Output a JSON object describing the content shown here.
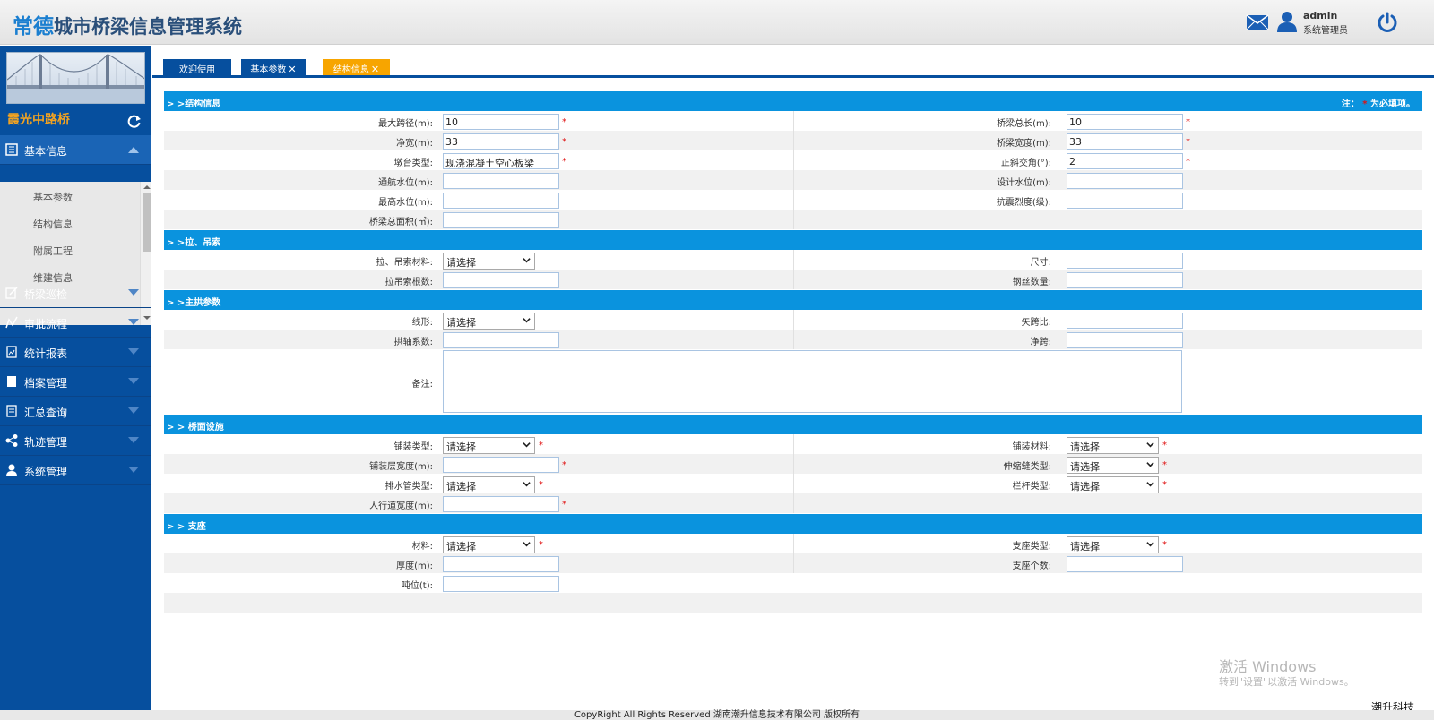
{
  "header": {
    "brand": "常德",
    "title_rest": "城市桥梁信息管理系统",
    "username": "admin",
    "role": "系统管理员"
  },
  "sidebar": {
    "bridge_name": "霞光中路桥",
    "groups": [
      {
        "label": "基本信息",
        "icon": "info-icon"
      },
      {
        "label": "桥梁巡检",
        "icon": "edit-icon"
      },
      {
        "label": "审批流程",
        "icon": "flow-icon"
      },
      {
        "label": "统计报表",
        "icon": "report-icon"
      },
      {
        "label": "档案管理",
        "icon": "archive-icon"
      },
      {
        "label": "汇总查询",
        "icon": "query-icon"
      },
      {
        "label": "轨迹管理",
        "icon": "share-icon"
      },
      {
        "label": "系统管理",
        "icon": "user-icon"
      }
    ],
    "sub_items": [
      "基本参数",
      "结构信息",
      "附属工程",
      "维建信息"
    ]
  },
  "tabs": {
    "welcome": "欢迎使用",
    "basic": "基本参数",
    "struct": "结构信息"
  },
  "sections": {
    "structure": "> >结构信息",
    "note_prefix": "注：",
    "note_star": "*",
    "note_suffix": "为必填项。",
    "cable": "> >拉、吊索",
    "arch": "> >主拱参数",
    "deck": "> > 桥面设施",
    "bearing": "> > 支座"
  },
  "structure": {
    "max_span_label": "最大跨径(m):",
    "max_span": "10",
    "total_length_label": "桥梁总长(m):",
    "total_length": "10",
    "net_width_label": "净宽(m):",
    "net_width": "33",
    "bridge_width_label": "桥梁宽度(m):",
    "bridge_width": "33",
    "abutment_label": "墩台类型:",
    "abutment": "现浇混凝土空心板梁",
    "skew_label": "正斜交角(°):",
    "skew": "2",
    "nav_level_label": "通航水位(m):",
    "design_level_label": "设计水位(m):",
    "max_level_label": "最高水位(m):",
    "seismic_label": "抗震烈度(级):",
    "area_label": "桥梁总面积(㎡):"
  },
  "cable": {
    "material_label": "拉、吊索材料:",
    "material": "请选择",
    "size_label": "尺寸:",
    "count_label": "拉吊索根数:",
    "wire_label": "钢丝数量:"
  },
  "arch": {
    "shape_label": "线形:",
    "shape": "请选择",
    "ratio_label": "矢跨比:",
    "coef_label": "拱轴系数:",
    "net_span_label": "净跨:",
    "remark_label": "备注:"
  },
  "deck": {
    "pave_type_label": "铺装类型:",
    "pave_type": "请选择",
    "pave_mat_label": "铺装材料:",
    "pave_mat": "请选择",
    "pave_width_label": "铺装层宽度(m):",
    "joint_label": "伸缩缝类型:",
    "joint": "请选择",
    "drain_label": "排水管类型:",
    "drain": "请选择",
    "rail_label": "栏杆类型:",
    "rail": "请选择",
    "walk_label": "人行道宽度(m):"
  },
  "bearing": {
    "material_label": "材料:",
    "material": "请选择",
    "type_label": "支座类型:",
    "type": "请选择",
    "thick_label": "厚度(m):",
    "count_label": "支座个数:",
    "tonnage_label": "吨位(t):"
  },
  "footer": {
    "copyright": "CopyRight All Rights Reserved 湖南潮升信息技术有限公司 版权所有",
    "wm1": "激活 Windows",
    "wm2": "转到\"设置\"以激活 Windows。",
    "corp": "潮升科技"
  },
  "colors": {
    "sidebar": "#064f9e",
    "section": "#0a93de",
    "active_tab": "#f7a500",
    "required": "#e01010"
  }
}
